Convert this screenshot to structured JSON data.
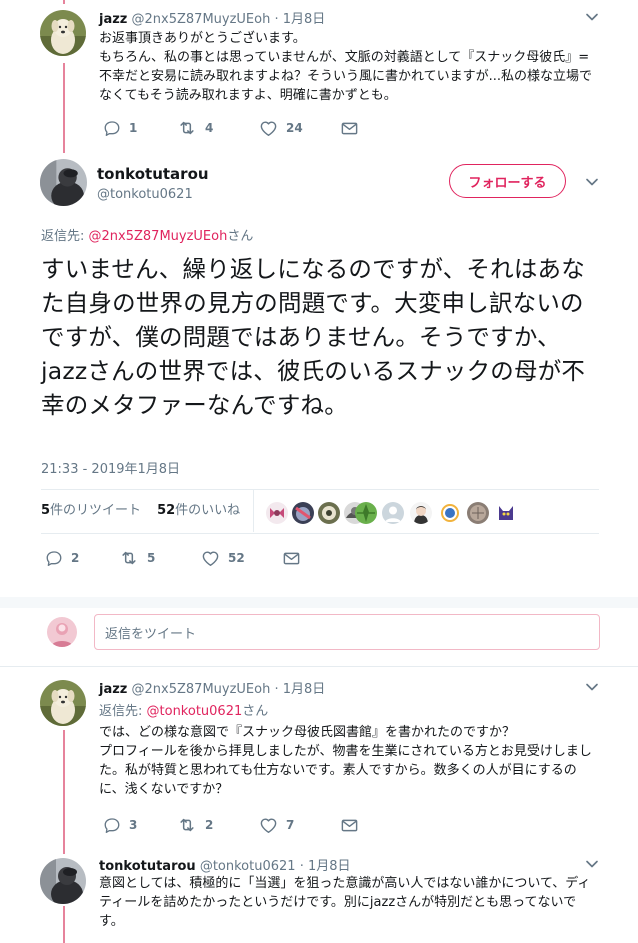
{
  "tweet1": {
    "name": "jazz",
    "handle": "@2nx5Z87MuyzUEoh",
    "date": "1月8日",
    "text": "お返事頂きありがとうございます。\nもちろん、私の事とは思っていませんが、文脈の対義語として『スナック母彼氏』=不幸だと安易に読み取れますよね？そういう風に書かれていますが...私の様な立場でなくてもそう読み取れますよ、明確に書かずとも。",
    "replies": "1",
    "retweets": "4",
    "likes": "24"
  },
  "main_tweet": {
    "name": "tonkotutarou",
    "handle": "@tonkotu0621",
    "follow_label": "フォローする",
    "reply_to_prefix": "返信先: ",
    "reply_to_handle": "@2nx5Z87MuyzUEoh",
    "reply_to_suffix": "さん",
    "text": "すいません、繰り返しになるのですが、それはあなた自身の世界の見方の問題です。大変申し訳ないのですが、僕の問題ではありません。そうですか、jazzさんの世界では、彼氏のいるスナックの母が不幸のメタファーなんですね。",
    "timestamp": "21:33 - 2019年1月8日",
    "retweet_count": "5",
    "retweet_label": "件のリツイート",
    "like_count": "52",
    "like_label": "件のいいね",
    "replies": "2",
    "retweets": "5",
    "likes": "52"
  },
  "reply_box": {
    "placeholder": "返信をツイート"
  },
  "tweet3": {
    "name": "jazz",
    "handle": "@2nx5Z87MuyzUEoh",
    "date": "1月8日",
    "reply_to_prefix": "返信先: ",
    "reply_to_handle": "@tonkotu0621",
    "reply_to_suffix": "さん",
    "text": "では、どの様な意図で『スナック母彼氏図書館』を書かれたのですか？\nプロフィールを後から拝見しましたが、物書を生業にされている方とお見受けしました。私が特質と思われても仕方ないです。素人ですから。数多くの人が目にするのに、浅くないですか？",
    "replies": "3",
    "retweets": "2",
    "likes": "7"
  },
  "tweet4": {
    "name": "tonkotutarou",
    "handle": "@tonkotu0621",
    "date": "1月8日",
    "text": "意図としては、積極的に「当選」を狙った意識が高い人ではない誰かについて、ディティールを詰めたかったというだけです。別にjazzさんが特別だとも思ってないです。"
  },
  "colors": {
    "accent": "#e0245e",
    "thread_line": "#e6839c",
    "secondary_text": "#657786",
    "primary_text": "#14171a",
    "divider": "#e6ecf0"
  },
  "icons": {
    "reply": "reply-icon",
    "retweet": "retweet-icon",
    "like": "heart-icon",
    "dm": "envelope-icon",
    "more": "chevron-down-icon"
  }
}
